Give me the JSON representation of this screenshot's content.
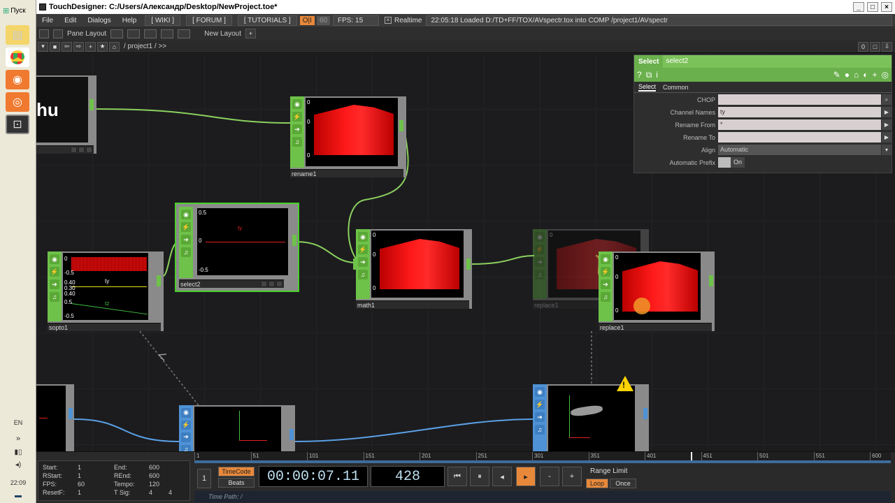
{
  "taskbar": {
    "start": "Пуск",
    "lang": "EN",
    "time": "22:09"
  },
  "title": "TouchDesigner: C:/Users/Александр/Desktop/NewProject.toe*",
  "menu": {
    "file": "File",
    "edit": "Edit",
    "dialogs": "Dialogs",
    "help": "Help",
    "wiki": "[ WIKI ]",
    "forum": "[ FORUM ]",
    "tutorials": "[ TUTORIALS ]",
    "oi": "O|I",
    "sixty": "60",
    "fps": "FPS:  15",
    "realtime": "Realtime",
    "log": "22:05:18 Loaded D:/TD+FF/TOX/AVspectr.tox into COMP /project1/AVspectr"
  },
  "panebar": {
    "pane_layout": "Pane Layout",
    "new_layout": "New Layout"
  },
  "pathbar": {
    "path": "/ project1 / >>",
    "zero": "0"
  },
  "nodes": {
    "hu": {
      "text": "hu"
    },
    "rename1": {
      "label": "rename1",
      "y0": "0",
      "y1": "0",
      "y2": "0"
    },
    "select2": {
      "label": "select2",
      "top": "0.5",
      "mid": "0",
      "bot": "-0.5",
      "series": "ty"
    },
    "sopto1": {
      "label": "sopto1",
      "v1": "0",
      "v2": "-0.5",
      "v3": "0.40",
      "v4": "0.30",
      "v5": "0.40",
      "v6": "0.5",
      "v7": "-0.5",
      "ty": "ty",
      "tz": "tz"
    },
    "math1": {
      "label": "math1",
      "y0": "0",
      "y1": "0",
      "y2": "0"
    },
    "replace1": {
      "label": "replace1",
      "y0": "0",
      "y1": "0",
      "y2": "0"
    },
    "replace1_ghost": {
      "label": "replace1",
      "y0": "0",
      "y1": "0",
      "y2": "0"
    }
  },
  "params": {
    "tab_label": "Select",
    "op_name": "select2",
    "tab_select": "Select",
    "tab_common": "Common",
    "rows": [
      {
        "label": "CHOP",
        "value": ""
      },
      {
        "label": "Channel Names",
        "value": "ty"
      },
      {
        "label": "Rename From",
        "value": "*"
      },
      {
        "label": "Rename To",
        "value": ""
      },
      {
        "label": "Align",
        "value": "Automatic"
      },
      {
        "label": "Automatic Prefix",
        "value": "On"
      }
    ]
  },
  "timeline": {
    "stats": {
      "start_l": "Start:",
      "start_v": "1",
      "end_l": "End:",
      "end_v": "600",
      "rstart_l": "RStart:",
      "rstart_v": "1",
      "rend_l": "REnd:",
      "rend_v": "600",
      "fps_l": "FPS:",
      "fps_v": "60",
      "tempo_l": "Tempo:",
      "tempo_v": "120",
      "resetf_l": "ResetF:",
      "resetf_v": "1",
      "tsig_l": "T Sig:",
      "tsig_v1": "4",
      "tsig_v2": "4"
    },
    "ruler": [
      "1",
      "51",
      "101",
      "151",
      "201",
      "251",
      "301",
      "351",
      "401",
      "451",
      "501",
      "551",
      "600"
    ],
    "timecode_btn": "TimeCode",
    "beats_btn": "Beats",
    "timecode": "00:00:07.11",
    "frame": "428",
    "range_limit": "Range Limit",
    "loop": "Loop",
    "once": "Once",
    "time_path": "Time Path: /",
    "one": "1"
  }
}
